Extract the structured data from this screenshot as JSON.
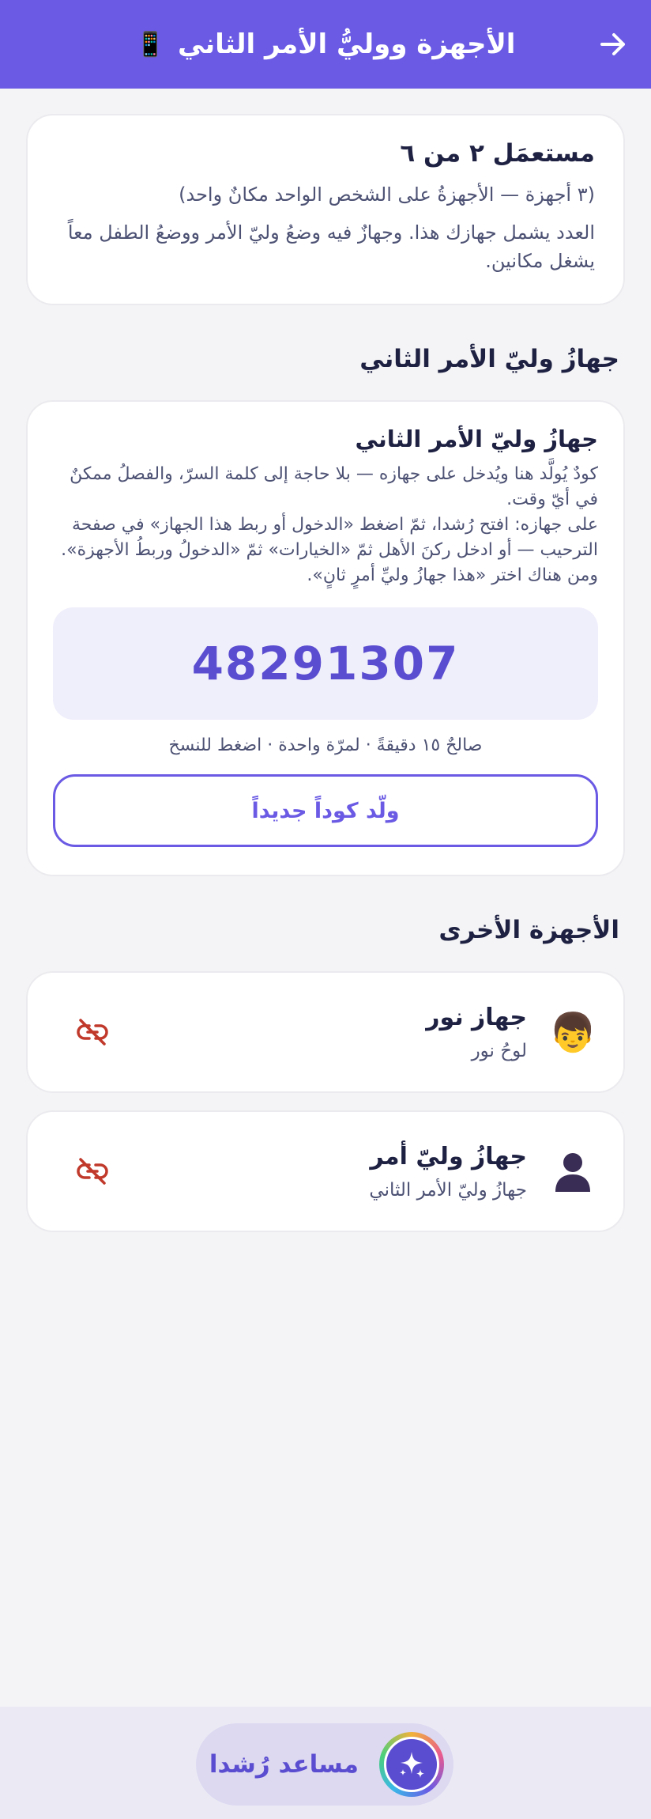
{
  "header": {
    "title": "الأجهزة ووليُّ الأمر الثاني",
    "emoji": "📱"
  },
  "usage": {
    "title": "مستعمَل ٢ من ٦",
    "subtitle": "(٣ أجهزة — الأجهزةُ على الشخص الواحد مكانٌ واحد)",
    "note": "العدد يشمل جهازك هذا. وجهازٌ فيه وضعُ وليّ الأمر ووضعُ الطفل معاً يشغل مكانين."
  },
  "second_guardian": {
    "section_title": "جهازُ وليّ الأمر الثاني",
    "card_title": "جهازُ وليّ الأمر الثاني",
    "desc_1": "كودٌ يُولَّد هنا ويُدخل على جهازه — بلا حاجة إلى كلمة السرّ، والفصلُ ممكنٌ في أيّ وقت.",
    "desc_2": "على جهازه: افتح رُشدا، ثمّ اضغط «الدخول أو ربط هذا الجهاز» في صفحة الترحيب — أو ادخل ركنَ الأهل ثمّ «الخيارات» ثمّ «الدخولُ وربطُ الأجهزة».",
    "desc_3": "ومن هناك اختر «هذا جهازُ وليِّ أمرٍ ثانٍ».",
    "code": "48291307",
    "validity": "صالحٌ ١٥ دقيقةً · لمرّة واحدة · اضغط للنسخ",
    "generate_label": "ولّد كوداً جديداً"
  },
  "other_devices": {
    "section_title": "الأجهزة الأخرى",
    "items": [
      {
        "name": "جهاز نور",
        "desc": "لوحُ نور",
        "avatar": "👦",
        "icon": "unlink-icon"
      },
      {
        "name": "جهازُ وليّ أمر",
        "desc": "جهازُ وليّ الأمر الثاني",
        "avatar": "👤",
        "icon": "unlink-icon"
      }
    ]
  },
  "assistant": {
    "label": "مساعد رُشدا"
  },
  "colors": {
    "primary": "#6a5ae4",
    "danger": "#c0392b",
    "text": "#1e2142",
    "muted": "#4d5274"
  }
}
